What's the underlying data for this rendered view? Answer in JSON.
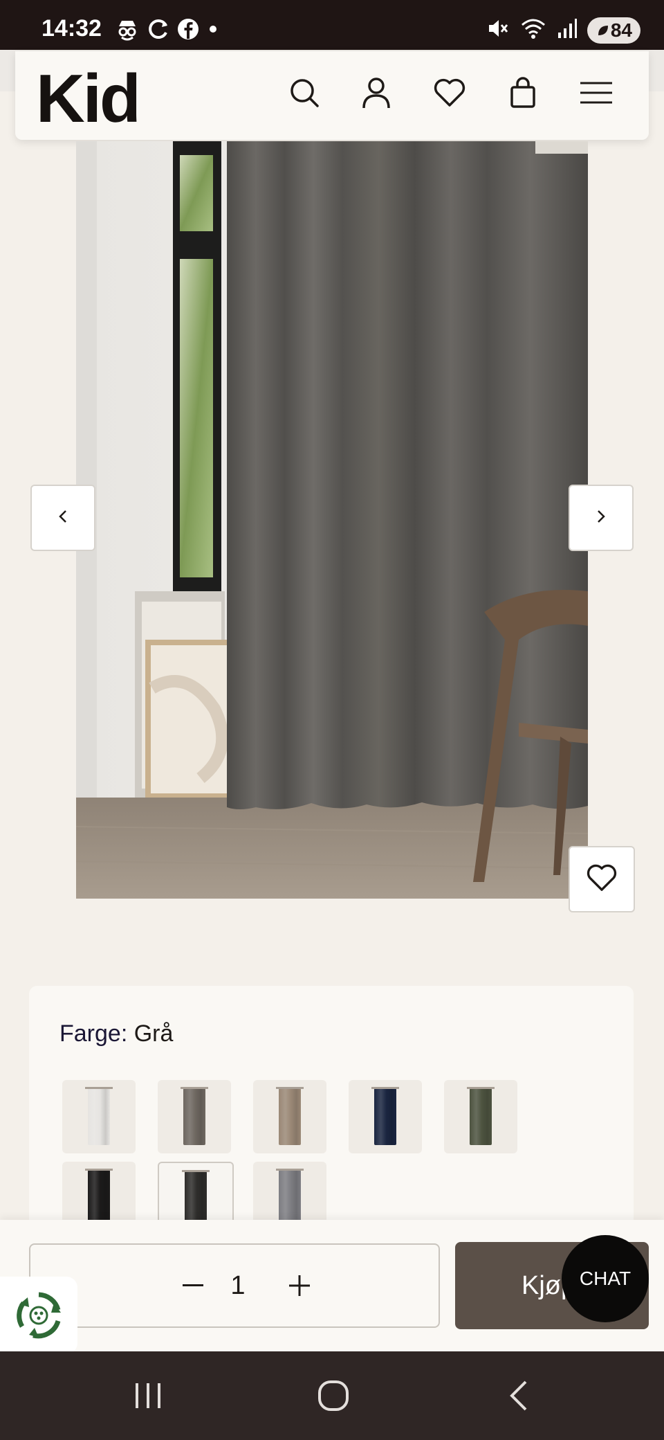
{
  "status_bar": {
    "time": "14:32",
    "battery": "84",
    "icons": [
      "incognito-icon",
      "sync-icon",
      "facebook-icon",
      "dot-icon",
      "mute-icon",
      "wifi-icon",
      "signal-icon",
      "battery-icon"
    ]
  },
  "header": {
    "logo": "Kid",
    "icons": [
      "search-icon",
      "account-icon",
      "wishlist-icon",
      "cart-icon",
      "menu-icon"
    ]
  },
  "gallery": {
    "prev_label": "‹",
    "next_label": "›"
  },
  "product": {
    "color_label": "Farge:",
    "color_value": "Grå",
    "swatches": [
      {
        "name": "white",
        "color": "#e6e4e1"
      },
      {
        "name": "grey-brown",
        "color": "#6e6760"
      },
      {
        "name": "beige",
        "color": "#9a8876"
      },
      {
        "name": "navy",
        "color": "#1a2540"
      },
      {
        "name": "olive",
        "color": "#4d5340"
      },
      {
        "name": "black",
        "color": "#1c1b1b"
      },
      {
        "name": "dark-grey",
        "color": "#2e2d2b",
        "selected": true
      },
      {
        "name": "grey",
        "color": "#7d7d82"
      }
    ]
  },
  "purchase": {
    "quantity": "1",
    "minus": "−",
    "plus": "+",
    "buy_label": "Kjøp"
  },
  "chat": {
    "label": "CHAT"
  },
  "colors": {
    "status_bar": "#1f1514",
    "page_bg": "#f4f0ea",
    "card_bg": "#faf8f4",
    "buy_button": "#5b5048",
    "nav_bar": "#2f2625",
    "recycle_green": "#2f6a36"
  }
}
